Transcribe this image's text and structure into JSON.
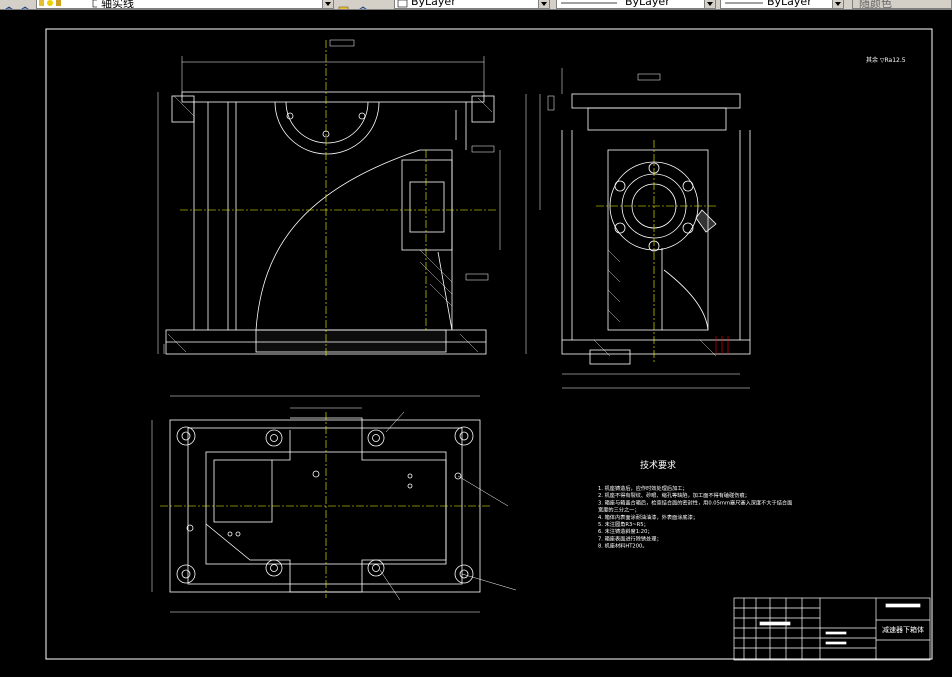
{
  "toolbar": {
    "layer_name": "轴实线",
    "color_value": "ByLayer",
    "linetype_value": "ByLayer",
    "lineweight_value": "ByLayer",
    "plotstyle_value": "随颜色"
  },
  "colors": {
    "background": "#000000",
    "lines": "#ffffff",
    "center_lines": "#ffff00",
    "hidden": "#ff0000"
  },
  "drawing": {
    "roughness_note": "其余 ▽Ra12.5",
    "tech_title": "技术要求",
    "tech_requirements": [
      "1. 机座铸造后，应作时效处理后加工；",
      "2. 机座不得有裂纹、砂眼、缩孔等缺陷，加工面不得有磕碰伤痕；",
      "3. 箱座与箱盖合箱后，检查结合面的密封性，用0.05mm塞尺塞入深度不大于结合面",
      "   宽度的三分之一；",
      "4. 箱体内表面涂耐油油漆，外表面涂底漆；",
      "5. 未注圆角R3~R5；",
      "6. 未注铸造斜度1:20；",
      "7. 箱座表面进行除锈处理；",
      "8. 机座材料HT200。"
    ],
    "title_block_name": "减速器下箱体",
    "icons": [
      "layer-icon",
      "layer-state-icon",
      "color-icon",
      "linetype-icon",
      "lineweight-icon"
    ]
  }
}
